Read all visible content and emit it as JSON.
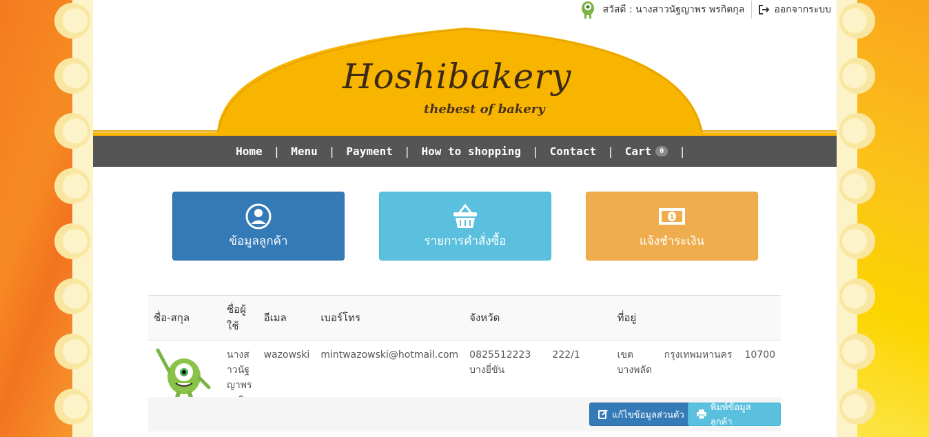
{
  "header": {
    "greeting": "สวัสดี : นางสาวนัฐญาพร พรกิตกุล",
    "logout_label": "ออกจากระบบ"
  },
  "logo": {
    "title": "Hoshibakery",
    "subtitle": "thebest of bakery"
  },
  "nav": {
    "items": [
      {
        "label": "Home"
      },
      {
        "label": "Menu"
      },
      {
        "label": "Payment"
      },
      {
        "label": "How to shopping"
      },
      {
        "label": "Contact"
      },
      {
        "label": "Cart"
      }
    ],
    "cart_count": "0"
  },
  "tiles": {
    "customer_label": "ข้อมูลลูกค้า",
    "orders_label": "รายการคำสั่งซื้อ",
    "payment_label": "แจ้งชำระเงิน"
  },
  "table": {
    "headers": [
      "ชื่อ-สกุล",
      "ชื่อผู้ใช้",
      "อีเมล",
      "เบอร์โทร",
      "จังหวัด",
      "ที่อยู่"
    ],
    "row": {
      "fullname": "นางสาวนัฐญาพร พรกิตกุล",
      "username": "wazowski",
      "email": "mintwazowski@hotmail.com",
      "phone": "0825512223",
      "house_no": "222/1",
      "subdistrict": "บางยี่ขัน",
      "district": "เขตบางพลัด",
      "province": "กรุงเทพมหานคร",
      "zip": "10700"
    }
  },
  "actions": {
    "edit_label": "แก้ไขข้อมูลส่วนตัว",
    "print_label": "พิมพ์ข้อมูลลูกค้า"
  },
  "colors": {
    "primary": "#337ab7",
    "info": "#5bc0de",
    "warning": "#f0ad4e",
    "nav_bg": "#555555",
    "banner_yellow": "#f8b500"
  },
  "icons": [
    "user-circle-icon",
    "basket-icon",
    "money-icon",
    "logout-icon",
    "edit-icon",
    "print-icon"
  ]
}
